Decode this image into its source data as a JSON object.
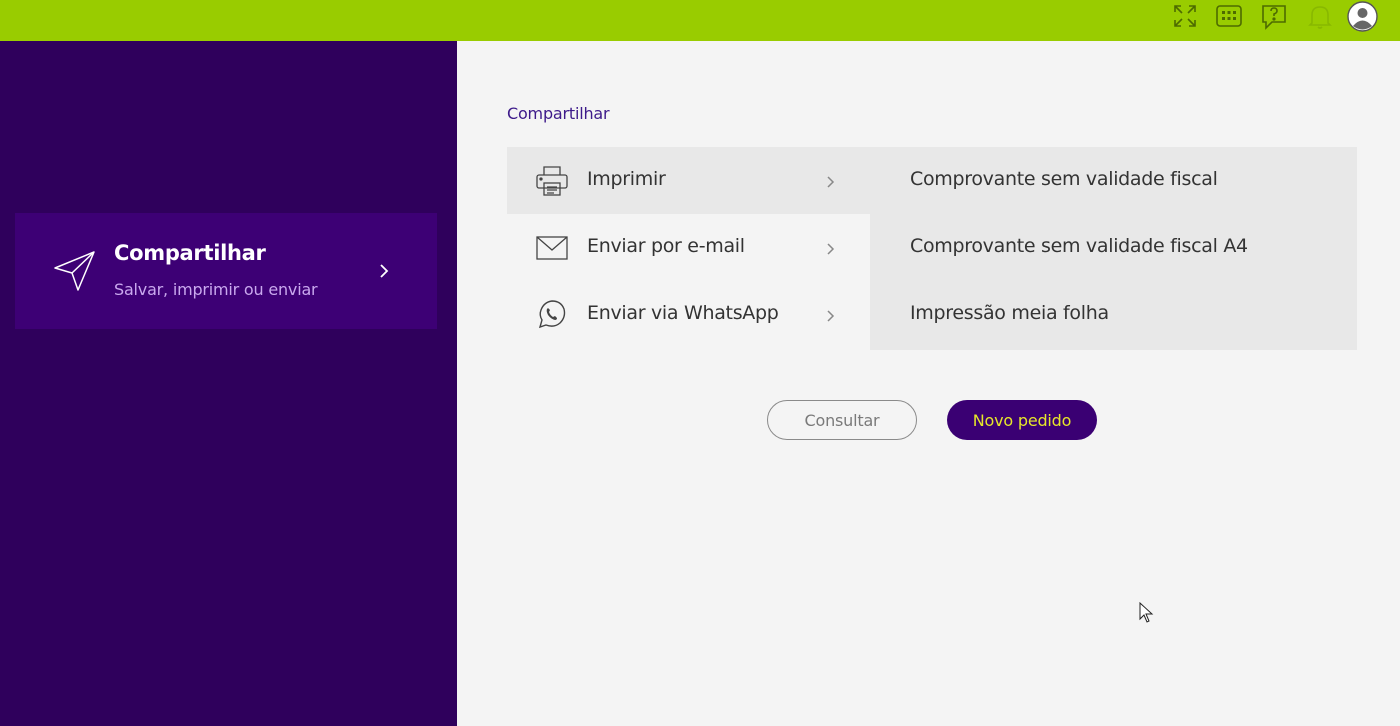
{
  "topbar": {
    "background": "#99cc00",
    "icons": [
      "fullscreen-icon",
      "keyboard-icon",
      "help-icon",
      "bell-icon",
      "user-avatar-icon"
    ]
  },
  "sidebar": {
    "background": "#2f005c",
    "share_card": {
      "title": "Compartilhar",
      "subtitle": "Salvar, imprimir ou enviar",
      "icon": "paper-plane-icon"
    }
  },
  "main": {
    "section_title": "Compartilhar",
    "menu": [
      {
        "label": "Imprimir",
        "icon": "printer-icon",
        "active": true
      },
      {
        "label": "Enviar por e-mail",
        "icon": "envelope-icon",
        "active": false
      },
      {
        "label": "Enviar via WhatsApp",
        "icon": "whatsapp-icon",
        "active": false
      }
    ],
    "submenu": [
      {
        "label": "Comprovante sem validade fiscal"
      },
      {
        "label": "Comprovante sem validade fiscal A4"
      },
      {
        "label": "Impressão meia folha"
      }
    ],
    "buttons": {
      "consult_label": "Consultar",
      "new_order_label": "Novo pedido"
    }
  },
  "colors": {
    "accent_purple": "#3a0073",
    "accent_yellow": "#e6e62a",
    "lime": "#99cc00"
  }
}
